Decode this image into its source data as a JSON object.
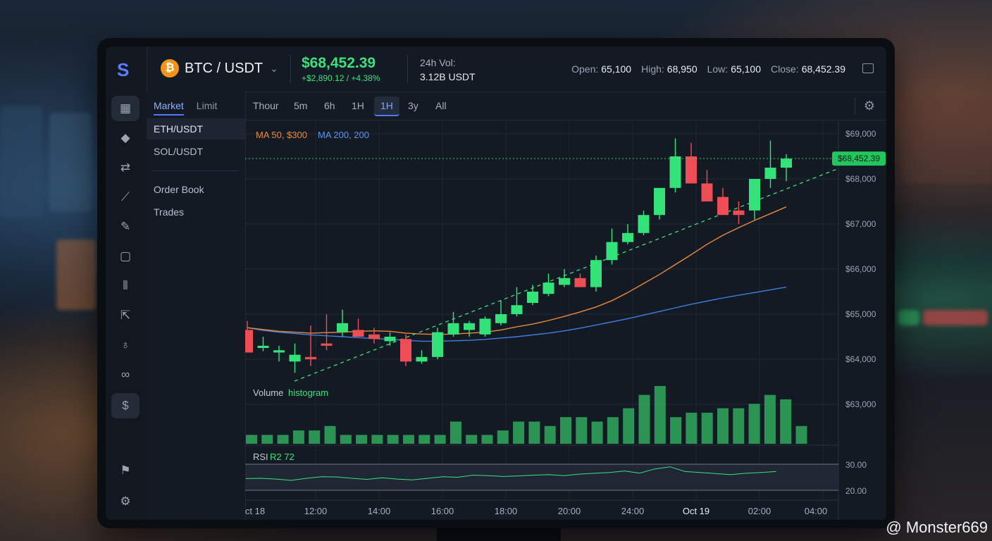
{
  "header": {
    "pair": "BTC / USDT",
    "coin_symbol": "₿",
    "price": "$68,452.39",
    "change": "+$2,890.12 / +4.38%",
    "volume_label": "24h Vol:",
    "volume_value": "3.12B USDT",
    "open_label": "Open:",
    "open_value": "65,100",
    "high_label": "High:",
    "high_value": "68,950",
    "low_label": "Low:",
    "low_value": "65,100",
    "close_label": "Close:",
    "close_value": "68,452.39"
  },
  "sidebar": {
    "tabs": [
      "Market",
      "Limit"
    ],
    "pairs": [
      "ETH/USDT",
      "SOL/USDT"
    ],
    "sections": [
      "Order Book",
      "Trades"
    ]
  },
  "rail_icons": [
    "dashboard-icon",
    "ethereum-icon",
    "swap-icon",
    "trend-icon",
    "pen-icon",
    "wallet-icon",
    "candles-icon",
    "export-icon",
    "bulb-icon",
    "link-icon",
    "dollar-icon",
    "bookmark-icon",
    "settings-icon"
  ],
  "toolbar": {
    "timeframes": [
      "Thour",
      "5m",
      "6h",
      "1H",
      "1H",
      "3y",
      "All"
    ],
    "active_index": 4
  },
  "chart_data": {
    "type": "candlestick",
    "indicators": {
      "ma50": "MA 50, $300",
      "ma200": "MA 200, 200"
    },
    "price_label": "$68,452.39",
    "y_ticks": [
      "$69,000",
      "$68,000",
      "$67,000",
      "$66,000",
      "$65,000",
      "$64,000",
      "$63,000"
    ],
    "x_ticks": [
      "ct 18",
      "12:00",
      "14:00",
      "16:00",
      "18:00",
      "20:00",
      "24:00",
      "Oct 19",
      "02:00",
      "04:00"
    ],
    "ohlc": [
      [
        64650,
        64850,
        64250,
        64150
      ],
      [
        64250,
        64500,
        64180,
        64300
      ],
      [
        64150,
        64300,
        63950,
        64200
      ],
      [
        63950,
        64350,
        63700,
        64100
      ],
      [
        64050,
        64750,
        63850,
        64000
      ],
      [
        64350,
        65000,
        64200,
        64300
      ],
      [
        64600,
        65100,
        64500,
        64800
      ],
      [
        64650,
        64900,
        64500,
        64500
      ],
      [
        64550,
        64700,
        64350,
        64450
      ],
      [
        64400,
        64600,
        64300,
        64500
      ],
      [
        64450,
        64550,
        63850,
        63950
      ],
      [
        63950,
        64200,
        63900,
        64050
      ],
      [
        64050,
        64700,
        64000,
        64600
      ],
      [
        64550,
        65050,
        64500,
        64800
      ],
      [
        64650,
        64850,
        64500,
        64800
      ],
      [
        64550,
        64950,
        64500,
        64900
      ],
      [
        64800,
        65300,
        64750,
        65000
      ],
      [
        65000,
        65600,
        64950,
        65200
      ],
      [
        65250,
        65650,
        65200,
        65500
      ],
      [
        65450,
        65900,
        65400,
        65700
      ],
      [
        65650,
        66000,
        65600,
        65800
      ],
      [
        65800,
        65900,
        65600,
        65600
      ],
      [
        65600,
        66300,
        65500,
        66200
      ],
      [
        66200,
        66900,
        66100,
        66600
      ],
      [
        66600,
        67000,
        66550,
        66800
      ],
      [
        66800,
        67300,
        66750,
        67200
      ],
      [
        67200,
        67800,
        67100,
        67800
      ],
      [
        67800,
        68900,
        67700,
        68500
      ],
      [
        68500,
        68800,
        67900,
        67900
      ],
      [
        67900,
        68200,
        67600,
        67500
      ],
      [
        67600,
        67800,
        67200,
        67200
      ],
      [
        67300,
        67500,
        67000,
        67200
      ],
      [
        67300,
        67800,
        67100,
        68000
      ],
      [
        68000,
        68850,
        67800,
        68250
      ],
      [
        68250,
        68550,
        67950,
        68450
      ]
    ],
    "ma50": [
      64700,
      64660,
      64620,
      64600,
      64580,
      64590,
      64600,
      64620,
      64630,
      64620,
      64580,
      64560,
      64550,
      64560,
      64580,
      64600,
      64650,
      64720,
      64780,
      64860,
      64950,
      65050,
      65160,
      65300,
      65480,
      65680,
      65880,
      66100,
      66320,
      66550,
      66750,
      66920,
      67080,
      67230,
      67380
    ],
    "ma200": [
      64700,
      64640,
      64600,
      64570,
      64540,
      64520,
      64500,
      64480,
      64460,
      64440,
      64420,
      64400,
      64400,
      64410,
      64420,
      64440,
      64470,
      64500,
      64540,
      64580,
      64630,
      64690,
      64760,
      64830,
      64900,
      64980,
      65060,
      65140,
      65220,
      65290,
      65360,
      65420,
      65480,
      65540,
      65600
    ],
    "volume_label": "Volume",
    "volume_sub": "histogram",
    "volume": [
      2,
      2,
      2,
      3,
      3,
      4,
      2,
      2,
      2,
      2,
      2,
      2,
      2,
      5,
      2,
      2,
      3,
      5,
      5,
      4,
      6,
      6,
      5,
      6,
      8,
      11,
      13,
      6,
      7,
      7,
      8,
      8,
      9,
      11,
      10,
      4
    ],
    "rsi_label": "RSI",
    "rsi_sub": "R2 72",
    "rsi_ticks": [
      "30.00",
      "20.00"
    ],
    "rsi": [
      24.5,
      24.6,
      24.3,
      23.8,
      24.6,
      25.2,
      25.1,
      24.6,
      24.2,
      24.8,
      24.3,
      24.0,
      24.6,
      25.2,
      25.0,
      25.8,
      25.6,
      25.3,
      25.5,
      25.8,
      26.0,
      25.6,
      26.2,
      26.5,
      26.8,
      27.4,
      26.6,
      28.2,
      29.0,
      27.2,
      26.8,
      26.4,
      26.0,
      26.5,
      26.8,
      27.2
    ]
  },
  "watermark": "@ Monster669"
}
